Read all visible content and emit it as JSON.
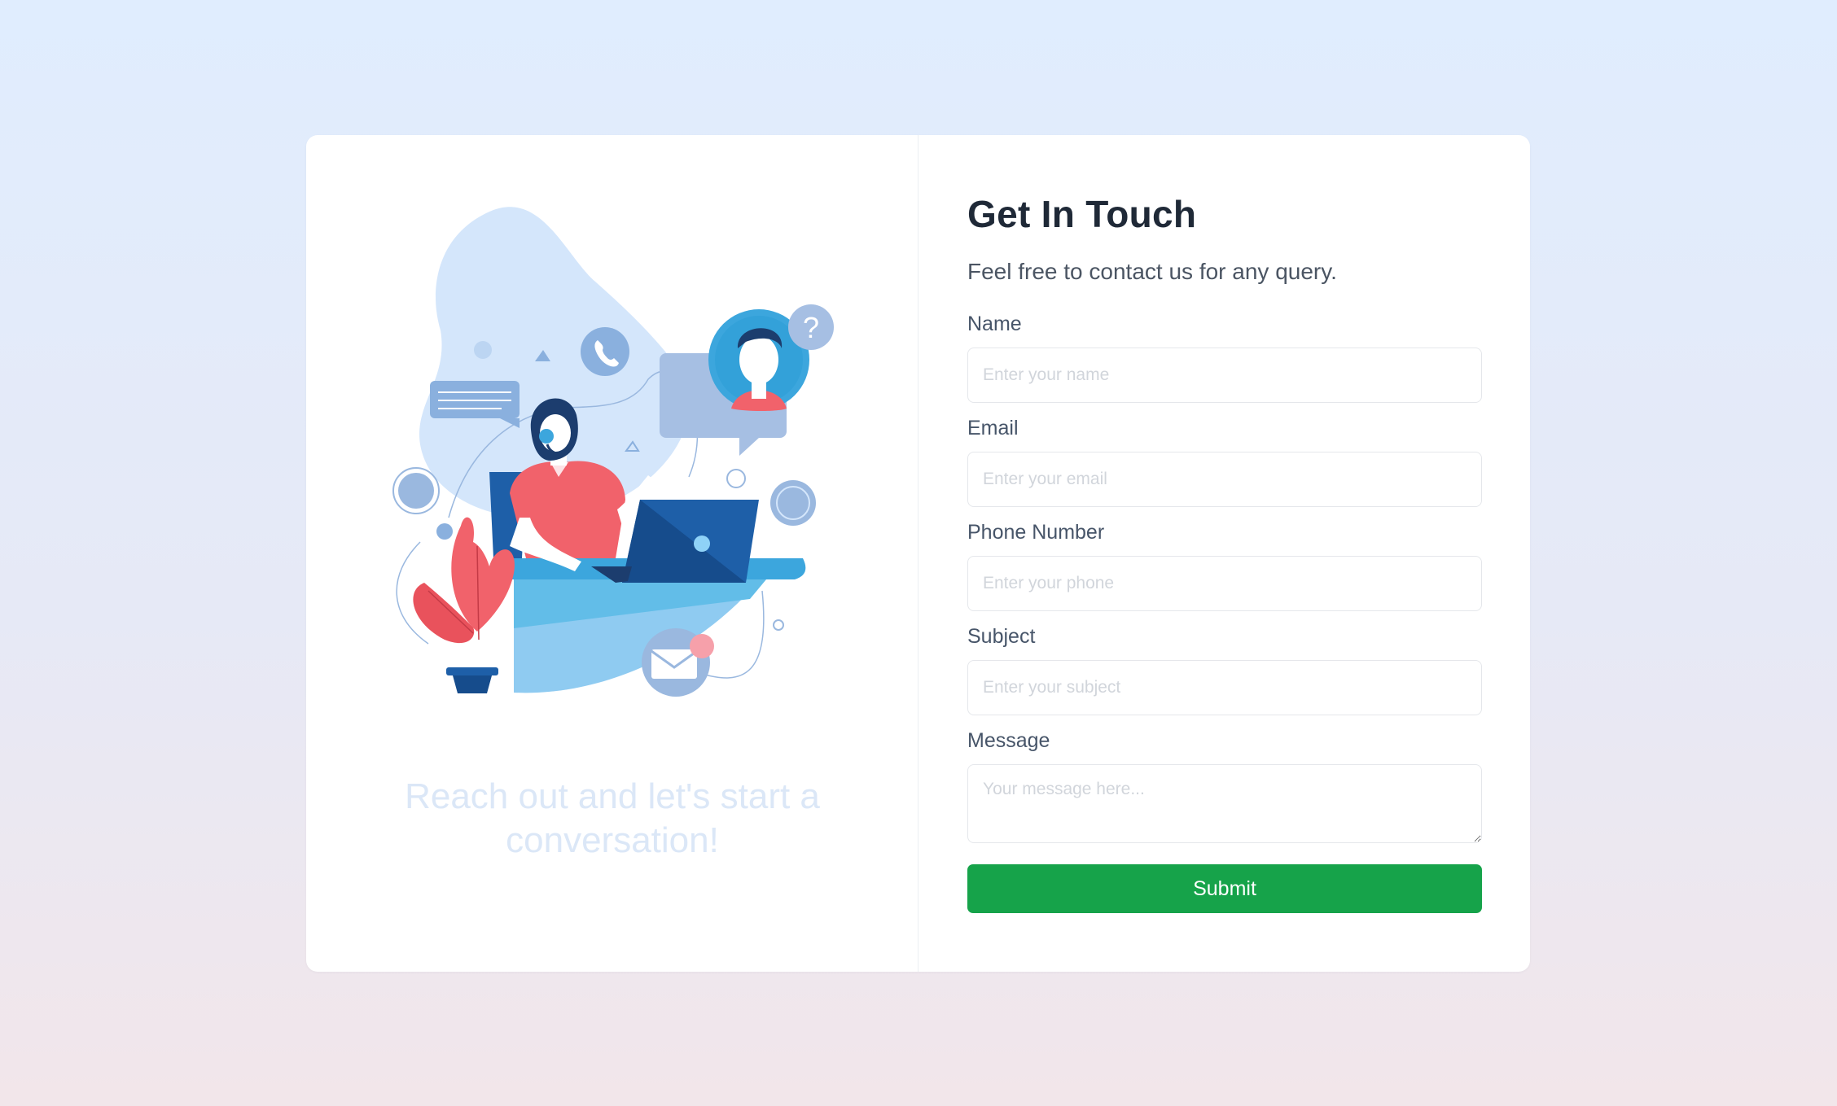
{
  "illustration": {
    "name": "customer-support-illustration",
    "colors": {
      "blob": "#d4e6fb",
      "accent_blue": "#3ca6dd",
      "dark_blue": "#1e5fa8",
      "pink": "#f1626b",
      "muted_blue": "#8ab0de"
    }
  },
  "tagline": "Reach out and let's start a conversation!",
  "form": {
    "title": "Get In Touch",
    "subtitle": "Feel free to contact us for any query.",
    "fields": {
      "name": {
        "label": "Name",
        "placeholder": "Enter your name",
        "value": ""
      },
      "email": {
        "label": "Email",
        "placeholder": "Enter your email",
        "value": ""
      },
      "phone": {
        "label": "Phone Number",
        "placeholder": "Enter your phone",
        "value": ""
      },
      "subject": {
        "label": "Subject",
        "placeholder": "Enter your subject",
        "value": ""
      },
      "message": {
        "label": "Message",
        "placeholder": "Your message here...",
        "value": ""
      }
    },
    "submit_label": "Submit",
    "submit_color": "#16a34a"
  }
}
